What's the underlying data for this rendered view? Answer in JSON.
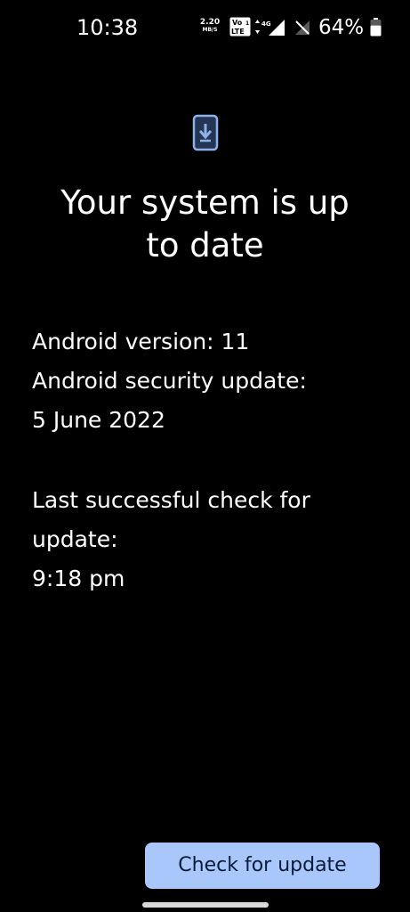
{
  "status_bar": {
    "time": "10:38",
    "net_speed_value": "2.20",
    "net_speed_unit": "MB/S",
    "volte_label": "Vo LTE 1",
    "network_type": "4G",
    "battery_percent": "64%",
    "battery_level": 0.64,
    "icons": [
      "volte-icon",
      "signal-strength-icon",
      "no-sim-signal-icon",
      "battery-icon"
    ]
  },
  "header": {
    "icon": "phone-download-icon",
    "title": "Your system is up\nto date"
  },
  "details": {
    "android_version": "Android version: 11",
    "security_update_label": "Android security update:",
    "security_update_date": "5 June 2022",
    "last_check_label_1": "Last successful check for",
    "last_check_label_2": "update:",
    "last_check_time": "9:18 pm"
  },
  "actions": {
    "check_button_label": "Check for update"
  },
  "colors": {
    "background": "#000000",
    "button_bg": "#a9c7fa",
    "button_text": "#0b1c3a",
    "icon_accent": "#8fb1e8"
  }
}
